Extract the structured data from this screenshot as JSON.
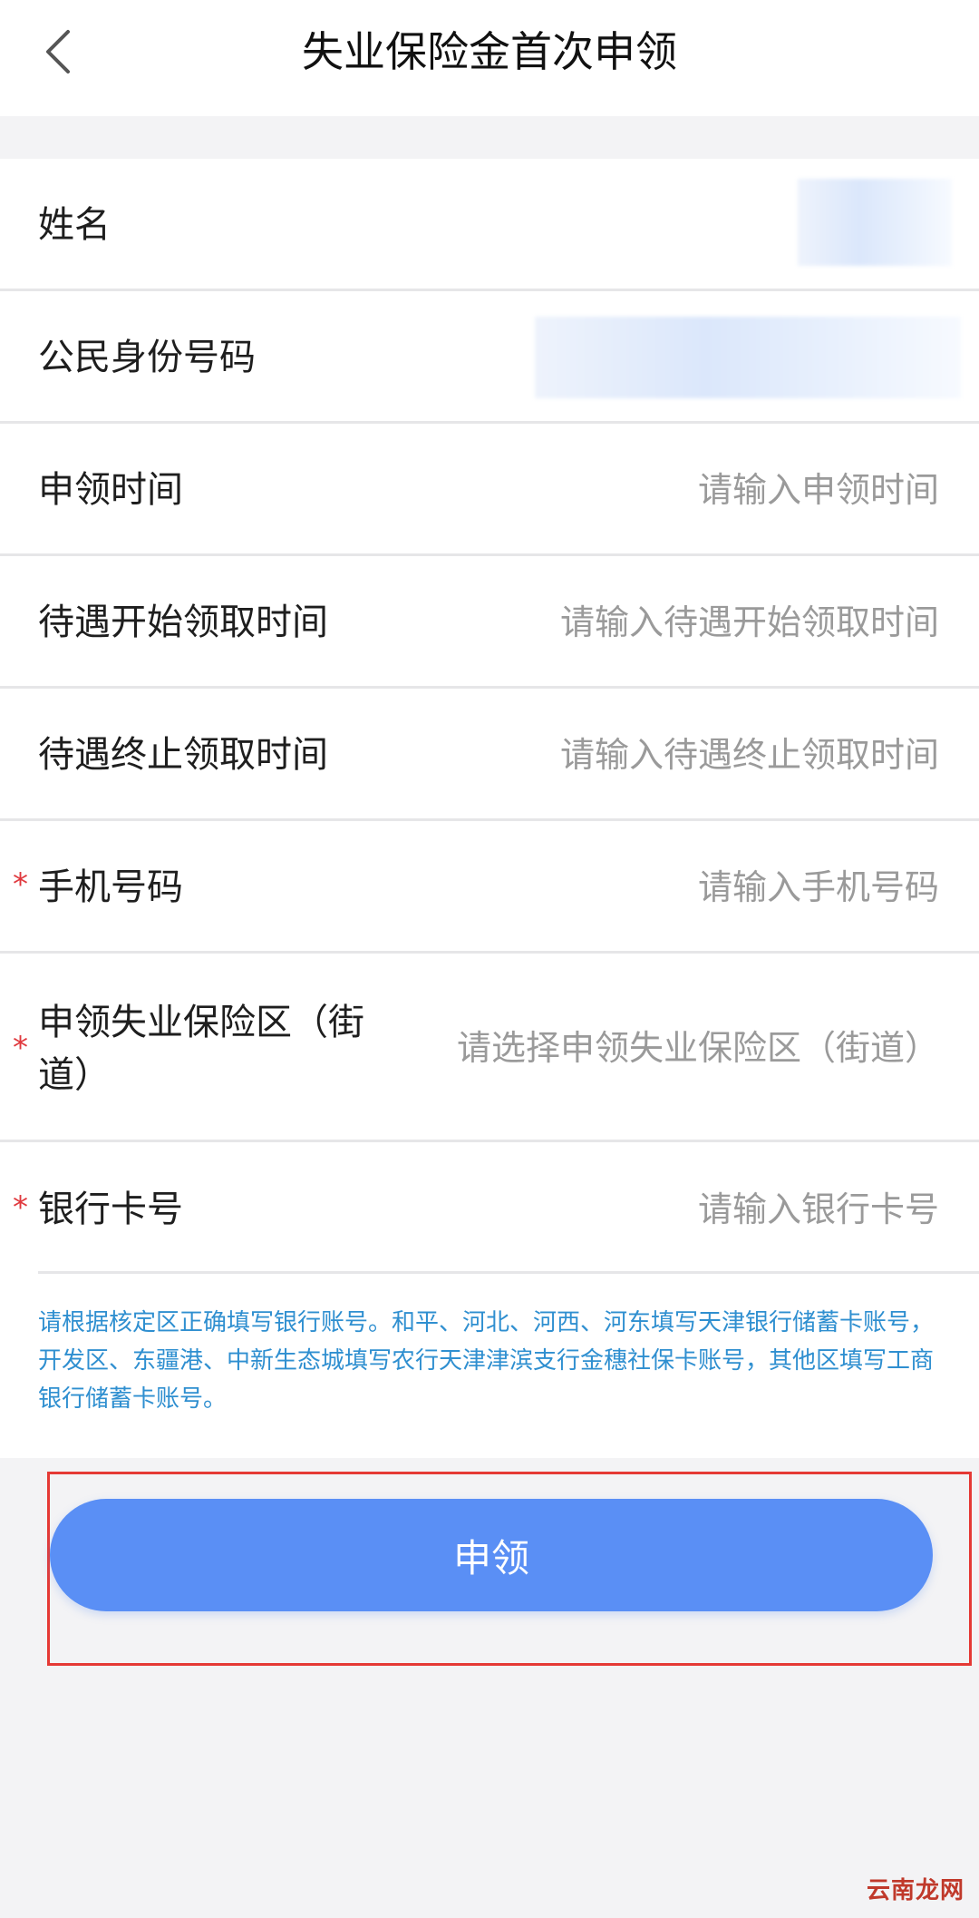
{
  "header": {
    "title": "失业保险金首次申领",
    "back_icon": "chevron-left-icon"
  },
  "form": {
    "name_label": "姓名",
    "id_label": "公民身份号码",
    "apply_time": {
      "label": "申领时间",
      "placeholder": "请输入申领时间"
    },
    "benefit_start": {
      "label": "待遇开始领取时间",
      "placeholder": "请输入待遇开始领取时间"
    },
    "benefit_end": {
      "label": "待遇终止领取时间",
      "placeholder": "请输入待遇终止领取时间"
    },
    "phone": {
      "required_mark": "*",
      "label": "手机号码",
      "placeholder": "请输入手机号码"
    },
    "district": {
      "required_mark": "*",
      "label_line1": "申领失业保险区（街",
      "label_line2": "道）",
      "placeholder": "请选择申领失业保险区（街道）"
    },
    "bank": {
      "required_mark": "*",
      "label": "银行卡号",
      "placeholder": "请输入银行卡号"
    },
    "note": "请根据核定区正确填写银行账号。和平、河北、河西、河东填写天津银行储蓄卡账号，开发区、东疆港、中新生态城填写农行天津津滨支行金穗社保卡账号，其他区填写工商银行储蓄卡账号。"
  },
  "submit_label": "申领",
  "watermark": "云南龙网",
  "colors": {
    "accent": "#5a8ff5",
    "required": "#e0393e",
    "note": "#2f8fd0",
    "highlight_border": "#e53935"
  }
}
